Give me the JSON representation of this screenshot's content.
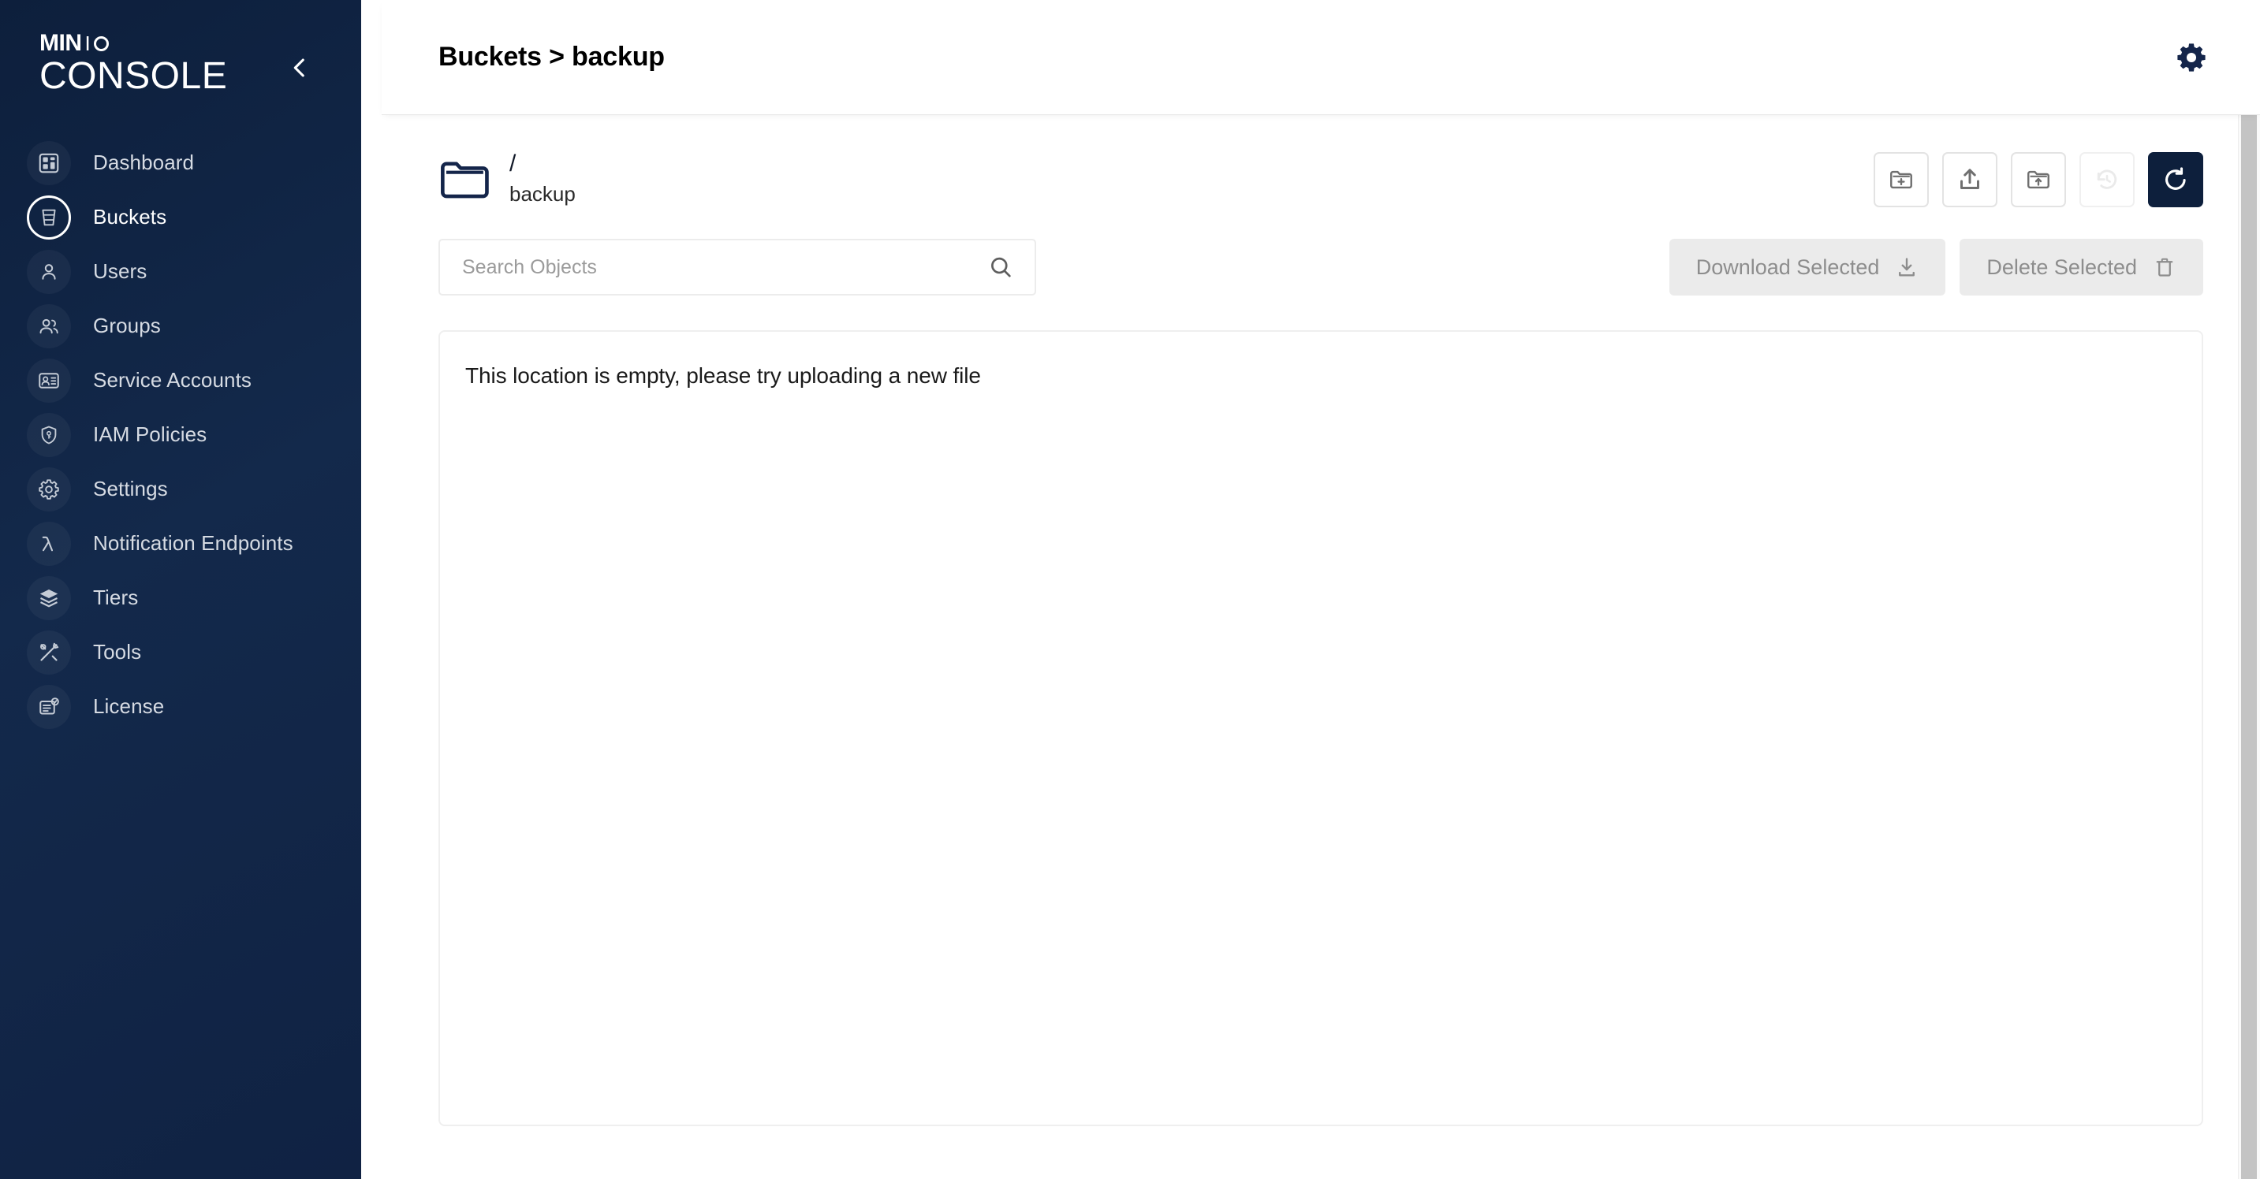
{
  "sidebar": {
    "brand": {
      "min": "MIN",
      "i": "I",
      "o": "o-circle",
      "console": "CONSOLE"
    },
    "collapse_icon": "chevron-left-icon",
    "items": [
      {
        "label": "Dashboard",
        "icon": "dashboard-icon",
        "active": false
      },
      {
        "label": "Buckets",
        "icon": "bucket-icon",
        "active": true
      },
      {
        "label": "Users",
        "icon": "user-icon",
        "active": false
      },
      {
        "label": "Groups",
        "icon": "groups-icon",
        "active": false
      },
      {
        "label": "Service Accounts",
        "icon": "id-card-icon",
        "active": false
      },
      {
        "label": "IAM Policies",
        "icon": "shield-key-icon",
        "active": false
      },
      {
        "label": "Settings",
        "icon": "gear-icon",
        "active": false
      },
      {
        "label": "Notification Endpoints",
        "icon": "lambda-icon",
        "active": false
      },
      {
        "label": "Tiers",
        "icon": "layers-icon",
        "active": false
      },
      {
        "label": "Tools",
        "icon": "tools-icon",
        "active": false
      },
      {
        "label": "License",
        "icon": "license-icon",
        "active": false
      }
    ]
  },
  "header": {
    "title": "Buckets > backup",
    "settings_icon": "gear-icon"
  },
  "browser": {
    "folder_icon": "folder-icon",
    "path_slash": "/",
    "bucket_name": "backup",
    "actions": [
      {
        "name": "create-new-path-button",
        "icon": "folder-plus-icon",
        "state": "enabled"
      },
      {
        "name": "upload-file-button",
        "icon": "upload-icon",
        "state": "enabled"
      },
      {
        "name": "upload-folder-button",
        "icon": "folder-upload-icon",
        "state": "enabled"
      },
      {
        "name": "rewind-button",
        "icon": "rewind-clock-icon",
        "state": "disabled"
      },
      {
        "name": "refresh-button",
        "icon": "refresh-icon",
        "state": "primary"
      }
    ]
  },
  "search": {
    "placeholder": "Search Objects",
    "value": "",
    "icon": "search-icon"
  },
  "selection_actions": {
    "download": {
      "label": "Download Selected",
      "icon": "download-icon",
      "disabled": true
    },
    "delete": {
      "label": "Delete Selected",
      "icon": "trash-icon",
      "disabled": true
    }
  },
  "objects": {
    "empty_message": "This location is empty, please try uploading a new file",
    "rows": []
  },
  "colors": {
    "sidebar_bg": "#0d1f3c",
    "accent_navy": "#0d1f3c",
    "disabled_gray": "#ebebeb",
    "disabled_text": "#8d8d8d",
    "scrollbar": "#c4c4c4"
  }
}
